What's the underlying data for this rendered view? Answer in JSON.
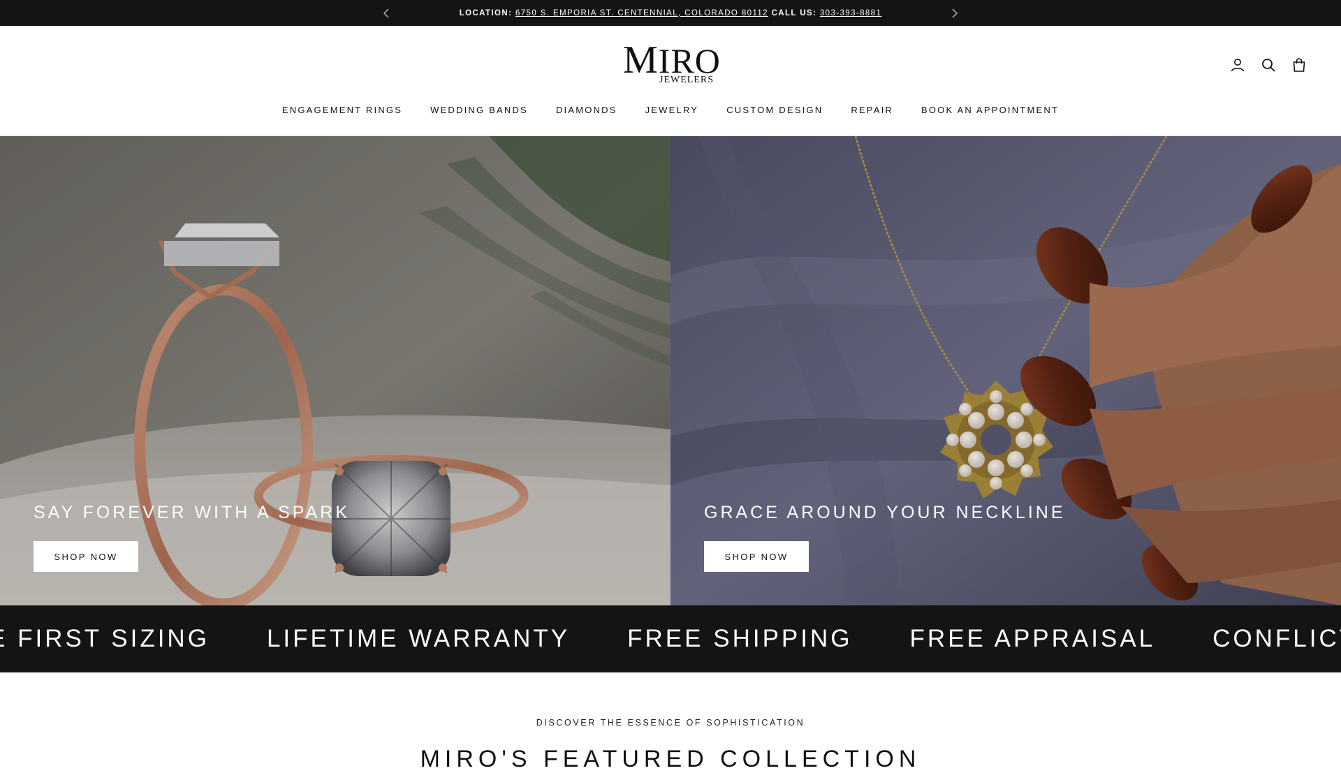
{
  "announcement": {
    "location_label": "LOCATION:",
    "address": "6750 S. EMPORIA ST. CENTENNIAL, COLORADO 80112",
    "call_label": "CALL US:",
    "phone": "303-393-8881",
    "prev_icon": "chevron-left-icon",
    "next_icon": "chevron-right-icon"
  },
  "brand": {
    "name_first": "M",
    "name_rest": "IRO",
    "subtitle": "JEWELERS"
  },
  "header_icons": [
    "account-icon",
    "search-icon",
    "cart-bag-icon"
  ],
  "nav": {
    "items": [
      {
        "label": "ENGAGEMENT RINGS"
      },
      {
        "label": "WEDDING BANDS"
      },
      {
        "label": "DIAMONDS"
      },
      {
        "label": "JEWELRY"
      },
      {
        "label": "CUSTOM DESIGN"
      },
      {
        "label": "REPAIR"
      },
      {
        "label": "BOOK AN APPOINTMENT"
      }
    ]
  },
  "hero": {
    "left": {
      "heading": "SAY FOREVER WITH A SPARK",
      "button": "SHOP NOW"
    },
    "right": {
      "heading": "GRACE AROUND YOUR NECKLINE",
      "button": "SHOP NOW"
    }
  },
  "marquee": {
    "items": [
      "E FIRST SIZING",
      "LIFETIME WARRANTY",
      "FREE SHIPPING",
      "FREE APPRAISAL",
      "CONFLICT"
    ]
  },
  "featured": {
    "eyebrow": "DISCOVER THE ESSENCE OF SOPHISTICATION",
    "title": "MIRO'S FEATURED COLLECTION"
  },
  "colors": {
    "bar_bg": "#141414",
    "text": "#111111",
    "white": "#ffffff"
  }
}
